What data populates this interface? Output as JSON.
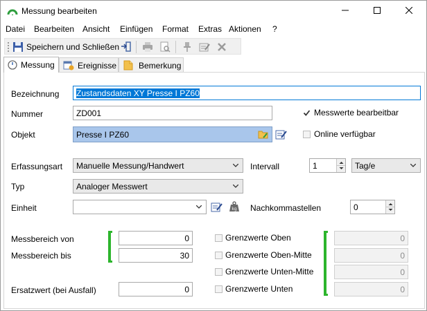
{
  "window": {
    "title": "Messung bearbeiten"
  },
  "menu": [
    "Datei",
    "Bearbeiten",
    "Ansicht",
    "Einfügen",
    "Format",
    "Extras",
    "Aktionen",
    "?"
  ],
  "toolbar": {
    "save_close_label": "Speichern und Schließen"
  },
  "tabs": [
    "Messung",
    "Ereignisse",
    "Bemerkung"
  ],
  "form": {
    "bezeichnung_label": "Bezeichnung",
    "bezeichnung_value": "Zustandsdaten XY Presse I PZ60",
    "nummer_label": "Nummer",
    "nummer_value": "ZD001",
    "objekt_label": "Objekt",
    "objekt_value": "Presse I PZ60",
    "messwerte_label": "Messwerte bearbeitbar",
    "online_label": "Online verfügbar",
    "erfassungsart_label": "Erfassungsart",
    "erfassungsart_value": "Manuelle Messung/Handwert",
    "intervall_label": "Intervall",
    "intervall_value": "1",
    "intervall_unit": "Tag/e",
    "typ_label": "Typ",
    "typ_value": "Analoger Messwert",
    "einheit_label": "Einheit",
    "einheit_value": "",
    "nachkomma_label": "Nachkommastellen",
    "nachkomma_value": "0",
    "messbereich_von_label": "Messbereich von",
    "messbereich_von_value": "0",
    "messbereich_bis_label": "Messbereich bis",
    "messbereich_bis_value": "30",
    "ersatzwert_label": "Ersatzwert (bei Ausfall)",
    "ersatzwert_value": "0",
    "grenz_oben_label": "Grenzwerte Oben",
    "grenz_oben_mitte_label": "Grenzwerte Oben-Mitte",
    "grenz_unten_mitte_label": "Grenzwerte Unten-Mitte",
    "grenz_unten_label": "Grenzwerte Unten",
    "grenz_oben_value": "0",
    "grenz_oben_mitte_value": "0",
    "grenz_unten_mitte_value": "0",
    "grenz_unten_value": "0"
  },
  "colors": {
    "selection": "#0078d7",
    "objekt_bg": "#a9c6eb",
    "bracket": "#2db52d"
  }
}
